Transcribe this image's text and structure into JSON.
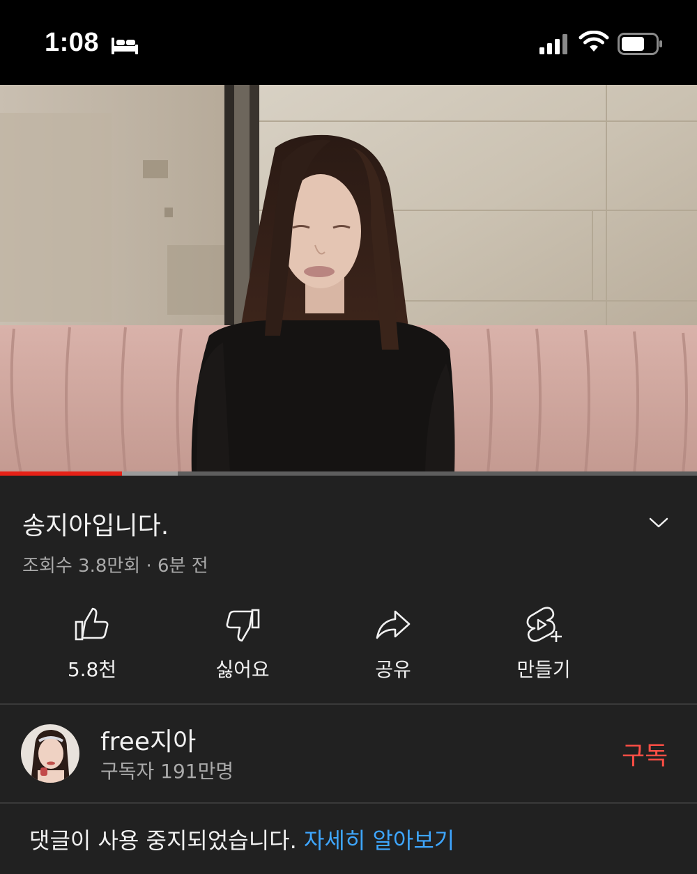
{
  "status_bar": {
    "time": "1:08",
    "icons": [
      "bed-sleep-icon",
      "cellular-signal-icon",
      "wifi-icon",
      "battery-icon"
    ]
  },
  "player": {
    "progress_played": 0.175,
    "progress_buffered": 0.255
  },
  "video": {
    "title": "송지아입니다.",
    "meta": "조회수 3.8만회 · 6분 전"
  },
  "actions": [
    {
      "icon": "thumbs-up-icon",
      "label": "5.8천"
    },
    {
      "icon": "thumbs-down-icon",
      "label": "싫어요"
    },
    {
      "icon": "share-icon",
      "label": "공유"
    },
    {
      "icon": "shorts-create-icon",
      "label": "만들기"
    }
  ],
  "channel": {
    "name": "free지아",
    "subscribers": "구독자 191만명",
    "subscribe_label": "구독"
  },
  "comments": {
    "notice": "댓글이 사용 중지되었습니다.",
    "link": "자세히 알아보기"
  },
  "colors": {
    "background": "#212121",
    "accent_red": "#e62117",
    "subscribe_red": "#ff4e45",
    "link_blue": "#3ea6ff"
  }
}
